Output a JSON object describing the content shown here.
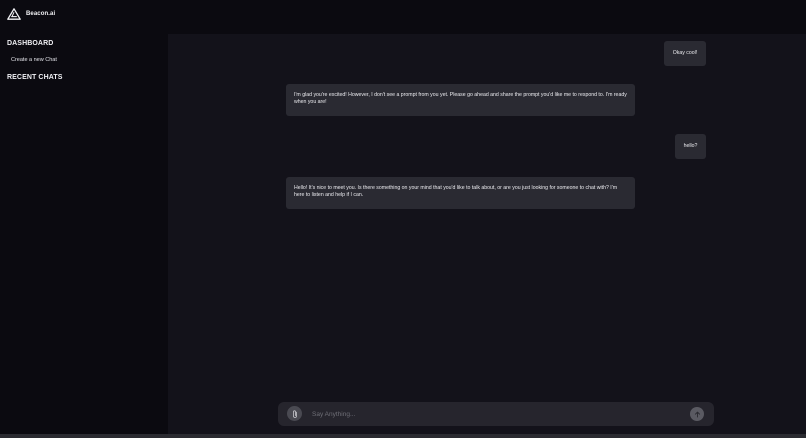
{
  "brand": {
    "name": "Beacon.ai",
    "logo_icon": "triangle-logo-icon"
  },
  "sidebar": {
    "dashboard_heading": "DASHBOARD",
    "new_chat_label": "Create a new Chat",
    "recent_heading": "RECENT CHATS"
  },
  "chat": {
    "messages": [
      {
        "role": "user",
        "text": "Okay cool!"
      },
      {
        "role": "assistant",
        "text": "I'm glad you're excited! However, I don't see a prompt from you yet. Please go ahead and share the prompt you'd like me to respond to. I'm ready when you are!"
      },
      {
        "role": "user",
        "text": "hello?"
      },
      {
        "role": "assistant",
        "text": "Hello! It's nice to meet you. Is there something on your mind that you'd like to talk about, or are you just looking for someone to chat with? I'm here to listen and help if I can."
      }
    ]
  },
  "composer": {
    "placeholder": "Say Anything...",
    "value": "",
    "attach_icon": "paperclip-icon",
    "send_icon": "arrow-up-icon"
  },
  "colors": {
    "sidebar_bg": "#0b0a10",
    "main_bg": "#13121a",
    "bubble_bg": "#2a2a32",
    "composer_bg": "#26252d"
  }
}
